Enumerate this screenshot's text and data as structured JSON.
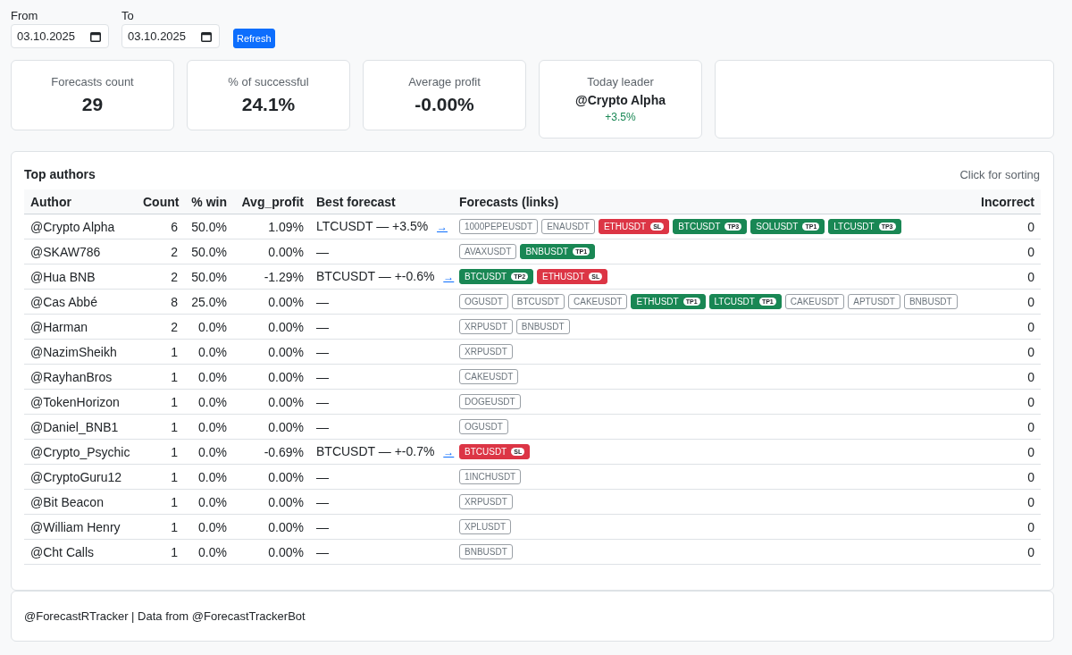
{
  "filters": {
    "from": {
      "label": "From",
      "value": "03.10.2025"
    },
    "to": {
      "label": "To",
      "value": "03.10.2025"
    },
    "refresh_button": "Refresh"
  },
  "stats": [
    {
      "kind": "metric",
      "label": "Forecasts count",
      "value": "29"
    },
    {
      "kind": "metric",
      "label": "% of successful",
      "value": "24.1%"
    },
    {
      "kind": "metric",
      "label": "Average profit",
      "value": "-0.00%"
    },
    {
      "kind": "leader",
      "label": "Today leader",
      "name": "@Crypto Alpha",
      "change": "+3.5%"
    },
    {
      "kind": "empty"
    }
  ],
  "top_authors": {
    "title": "Top authors",
    "hint": "Click for sorting",
    "columns": [
      "Author",
      "Count",
      "% win",
      "Avg_profit",
      "Best forecast",
      "Forecasts (links)",
      "Incorrect"
    ],
    "rows": [
      {
        "author": "@Crypto Alpha",
        "count": "6",
        "win_rate": "50.0%",
        "avg_profit": "1.09%",
        "best_forecast": {
          "text": "LTCUSDT — +3.5%",
          "link": "→"
        },
        "forecasts": [
          {
            "symbol": "1000PEPEUSDT",
            "kind": "open"
          },
          {
            "symbol": "ENAUSDT",
            "kind": "open"
          },
          {
            "symbol": "ETHUSDT",
            "kind": "loss",
            "tag": "SL"
          },
          {
            "symbol": "BTCUSDT",
            "kind": "profit",
            "tag": "TP3"
          },
          {
            "symbol": "SOLUSDT",
            "kind": "profit",
            "tag": "TP1"
          },
          {
            "symbol": "LTCUSDT",
            "kind": "profit",
            "tag": "TP3"
          }
        ],
        "incorrect": "0"
      },
      {
        "author": "@SKAW786",
        "count": "2",
        "win_rate": "50.0%",
        "avg_profit": "0.00%",
        "best_forecast": {
          "text": "—"
        },
        "forecasts": [
          {
            "symbol": "AVAXUSDT",
            "kind": "open"
          },
          {
            "symbol": "BNBUSDT",
            "kind": "profit",
            "tag": "TP1"
          }
        ],
        "incorrect": "0"
      },
      {
        "author": "@Hua BNB",
        "count": "2",
        "win_rate": "50.0%",
        "avg_profit": "-1.29%",
        "best_forecast": {
          "text": "BTCUSDT — +-0.6%",
          "link": "→"
        },
        "forecasts": [
          {
            "symbol": "BTCUSDT",
            "kind": "profit",
            "tag": "TP2"
          },
          {
            "symbol": "ETHUSDT",
            "kind": "loss",
            "tag": "SL"
          }
        ],
        "incorrect": "0"
      },
      {
        "author": "@Cas Abbé",
        "count": "8",
        "win_rate": "25.0%",
        "avg_profit": "0.00%",
        "best_forecast": {
          "text": "—"
        },
        "forecasts": [
          {
            "symbol": "OGUSDT",
            "kind": "open"
          },
          {
            "symbol": "BTCUSDT",
            "kind": "open"
          },
          {
            "symbol": "CAKEUSDT",
            "kind": "open"
          },
          {
            "symbol": "ETHUSDT",
            "kind": "profit",
            "tag": "TP1"
          },
          {
            "symbol": "LTCUSDT",
            "kind": "profit",
            "tag": "TP1"
          },
          {
            "symbol": "CAKEUSDT",
            "kind": "open"
          },
          {
            "symbol": "APTUSDT",
            "kind": "open"
          },
          {
            "symbol": "BNBUSDT",
            "kind": "open"
          }
        ],
        "incorrect": "0"
      },
      {
        "author": "@Harman",
        "count": "2",
        "win_rate": "0.0%",
        "avg_profit": "0.00%",
        "best_forecast": {
          "text": "—"
        },
        "forecasts": [
          {
            "symbol": "XRPUSDT",
            "kind": "open"
          },
          {
            "symbol": "BNBUSDT",
            "kind": "open"
          }
        ],
        "incorrect": "0"
      },
      {
        "author": "@NazimSheikh",
        "count": "1",
        "win_rate": "0.0%",
        "avg_profit": "0.00%",
        "best_forecast": {
          "text": "—"
        },
        "forecasts": [
          {
            "symbol": "XRPUSDT",
            "kind": "open"
          }
        ],
        "incorrect": "0"
      },
      {
        "author": "@RayhanBros",
        "count": "1",
        "win_rate": "0.0%",
        "avg_profit": "0.00%",
        "best_forecast": {
          "text": "—"
        },
        "forecasts": [
          {
            "symbol": "CAKEUSDT",
            "kind": "open"
          }
        ],
        "incorrect": "0"
      },
      {
        "author": "@TokenHorizon",
        "count": "1",
        "win_rate": "0.0%",
        "avg_profit": "0.00%",
        "best_forecast": {
          "text": "—"
        },
        "forecasts": [
          {
            "symbol": "DOGEUSDT",
            "kind": "open"
          }
        ],
        "incorrect": "0"
      },
      {
        "author": "@Daniel_BNB1",
        "count": "1",
        "win_rate": "0.0%",
        "avg_profit": "0.00%",
        "best_forecast": {
          "text": "—"
        },
        "forecasts": [
          {
            "symbol": "OGUSDT",
            "kind": "open"
          }
        ],
        "incorrect": "0"
      },
      {
        "author": "@Crypto_Psychic",
        "count": "1",
        "win_rate": "0.0%",
        "avg_profit": "-0.69%",
        "best_forecast": {
          "text": "BTCUSDT — +-0.7%",
          "link": "→"
        },
        "forecasts": [
          {
            "symbol": "BTCUSDT",
            "kind": "loss",
            "tag": "SL"
          }
        ],
        "incorrect": "0"
      },
      {
        "author": "@CryptoGuru12",
        "count": "1",
        "win_rate": "0.0%",
        "avg_profit": "0.00%",
        "best_forecast": {
          "text": "—"
        },
        "forecasts": [
          {
            "symbol": "1INCHUSDT",
            "kind": "open"
          }
        ],
        "incorrect": "0"
      },
      {
        "author": "@Bit Beacon",
        "count": "1",
        "win_rate": "0.0%",
        "avg_profit": "0.00%",
        "best_forecast": {
          "text": "—"
        },
        "forecasts": [
          {
            "symbol": "XRPUSDT",
            "kind": "open"
          }
        ],
        "incorrect": "0"
      },
      {
        "author": "@William Henry",
        "count": "1",
        "win_rate": "0.0%",
        "avg_profit": "0.00%",
        "best_forecast": {
          "text": "—"
        },
        "forecasts": [
          {
            "symbol": "XPLUSDT",
            "kind": "open"
          }
        ],
        "incorrect": "0"
      },
      {
        "author": "@Cht Calls",
        "count": "1",
        "win_rate": "0.0%",
        "avg_profit": "0.00%",
        "best_forecast": {
          "text": "—"
        },
        "forecasts": [
          {
            "symbol": "BNBUSDT",
            "kind": "open"
          }
        ],
        "incorrect": "0"
      }
    ]
  },
  "footer": "@ForecastRTracker | Data from @ForecastTrackerBot"
}
